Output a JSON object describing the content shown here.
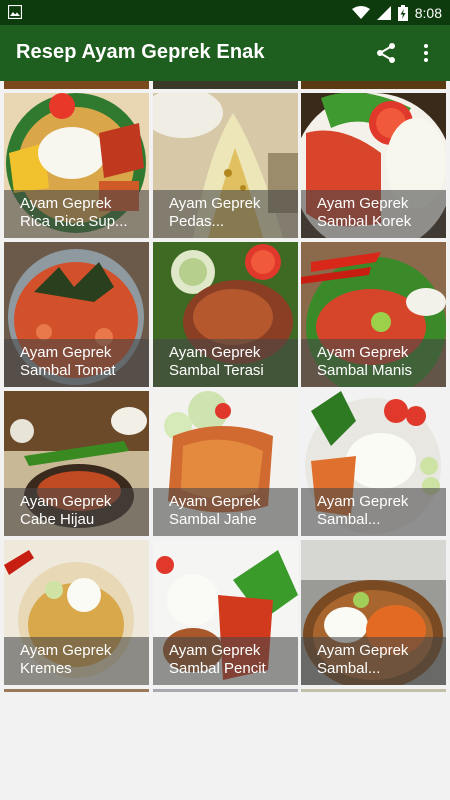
{
  "status_bar": {
    "time": "8:08",
    "notification_icon": "image-icon",
    "icons": [
      "wifi-icon",
      "signal-icon",
      "battery-charging-icon"
    ]
  },
  "app_bar": {
    "title": "Resep Ayam Geprek Enak",
    "actions": [
      "share-icon",
      "more-vert-icon"
    ],
    "background": "#1e5e1e",
    "status_background": "#0d3b0d"
  },
  "recipes": [
    {
      "line1": "Ayam Geprek",
      "line2": "Rica Rica Sup..."
    },
    {
      "line1": "Ayam Geprek",
      "line2": "Pedas..."
    },
    {
      "line1": "Ayam Geprek",
      "line2": "Sambal Korek"
    },
    {
      "line1": "Ayam Geprek",
      "line2": "Sambal Tomat"
    },
    {
      "line1": "Ayam Geprek",
      "line2": "Sambal Terasi"
    },
    {
      "line1": "Ayam Geprek",
      "line2": "Sambal Manis"
    },
    {
      "line1": "Ayam Geprek",
      "line2": "Cabe Hijau"
    },
    {
      "line1": "Ayam Geprek",
      "line2": "Sambal Jahe"
    },
    {
      "line1": "Ayam Geprek",
      "line2": "Sambal..."
    },
    {
      "line1": "Ayam Geprek",
      "line2": "Kremes"
    },
    {
      "line1": "Ayam Geprek",
      "line2": "Sambal Pencit"
    },
    {
      "line1": "Ayam Geprek",
      "line2": "Sambal..."
    }
  ]
}
